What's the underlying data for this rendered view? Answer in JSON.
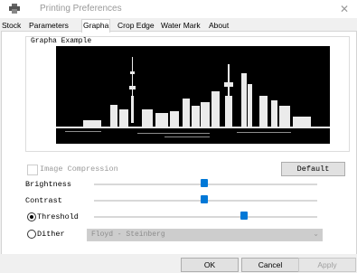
{
  "window": {
    "title": "Printing Preferences",
    "close_glyph": "✕"
  },
  "tabs": [
    {
      "label": "Stock"
    },
    {
      "label": "Parameters"
    },
    {
      "label": "Grapha",
      "active": true
    },
    {
      "label": "Crop Edge"
    },
    {
      "label": "Water Mark"
    },
    {
      "label": "About"
    }
  ],
  "group": {
    "title": "Grapha Example"
  },
  "image_compression": {
    "label": "Image Compression",
    "checked": false
  },
  "default_button": "Default",
  "brightness": {
    "label": "Brightness",
    "level": 0.5
  },
  "contrast": {
    "label": "Contrast",
    "level": 0.5
  },
  "threshold": {
    "label": "Threshold",
    "selected": true,
    "level": 0.68
  },
  "dither": {
    "label": "Dither",
    "selected": false,
    "algorithm": "Floyd - Steinberg"
  },
  "footer": {
    "ok": "OK",
    "cancel": "Cancel",
    "apply": "Apply"
  },
  "colors": {
    "accent": "#0078d7",
    "preview_bg": "#000000"
  },
  "icons": {
    "printer": "printer-icon",
    "close": "close-icon",
    "dropdown": "chevron-down-icon"
  }
}
